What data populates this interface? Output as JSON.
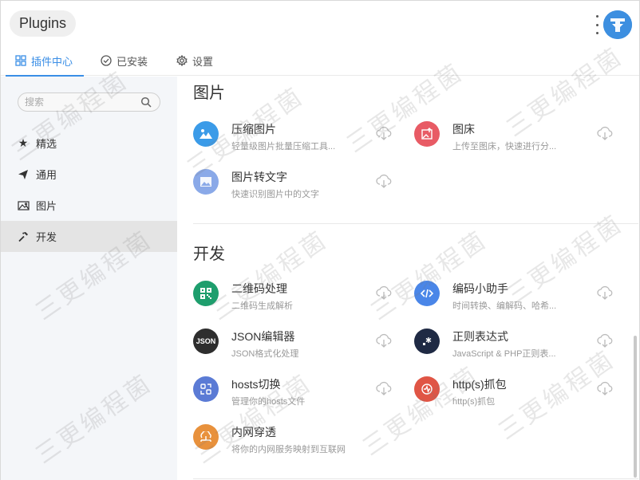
{
  "app": {
    "title": "Plugins"
  },
  "tabs": [
    {
      "label": "插件中心",
      "icon": "grid-icon",
      "active": true
    },
    {
      "label": "已安装",
      "icon": "check-circle-icon",
      "active": false
    },
    {
      "label": "设置",
      "icon": "gear-icon",
      "active": false
    }
  ],
  "search": {
    "placeholder": "搜索"
  },
  "sidebar": {
    "items": [
      {
        "label": "精选",
        "icon": "star-icon"
      },
      {
        "label": "通用",
        "icon": "send-icon"
      },
      {
        "label": "图片",
        "icon": "image-icon"
      },
      {
        "label": "开发",
        "icon": "hammer-icon",
        "active": true
      }
    ]
  },
  "sections": {
    "images": {
      "title": "图片",
      "plugins": [
        {
          "name": "压缩图片",
          "desc": "轻量级图片批量压缩工具...",
          "icon": "mountain-icon",
          "color": "#3b9be8"
        },
        {
          "name": "图床",
          "desc": "上传至图床，快速进行分...",
          "icon": "image-upload-icon",
          "color": "#e85b65"
        },
        {
          "name": "图片转文字",
          "desc": "快速识别图片中的文字",
          "icon": "image-text-icon",
          "color": "#8aa9e8"
        }
      ]
    },
    "dev": {
      "title": "开发",
      "plugins": [
        {
          "name": "二维码处理",
          "desc": "二维码生成解析",
          "icon": "qrcode-icon",
          "color": "#1e9e6d"
        },
        {
          "name": "编码小助手",
          "desc": "时间转换、编解码、哈希...",
          "icon": "code-icon",
          "color": "#4a86e8"
        },
        {
          "name": "JSON编辑器",
          "desc": "JSON格式化处理",
          "icon": "json-icon",
          "icon_text": "JSON",
          "color": "#2e2e2e"
        },
        {
          "name": "正则表达式",
          "desc": "JavaScript & PHP正则表...",
          "icon": "regex-icon",
          "color": "#1f2a44"
        },
        {
          "name": "hosts切换",
          "desc": "管理你的hosts文件",
          "icon": "switch-icon",
          "color": "#5b7bd5"
        },
        {
          "name": "http(s)抓包",
          "desc": "http(s)抓包",
          "icon": "capture-icon",
          "color": "#e05545"
        },
        {
          "name": "内网穿透",
          "desc": "将你的内网服务映射到互联网",
          "icon": "tunnel-icon",
          "color": "#e8913c"
        }
      ]
    }
  },
  "watermark": {
    "text": "三更编程菌"
  }
}
